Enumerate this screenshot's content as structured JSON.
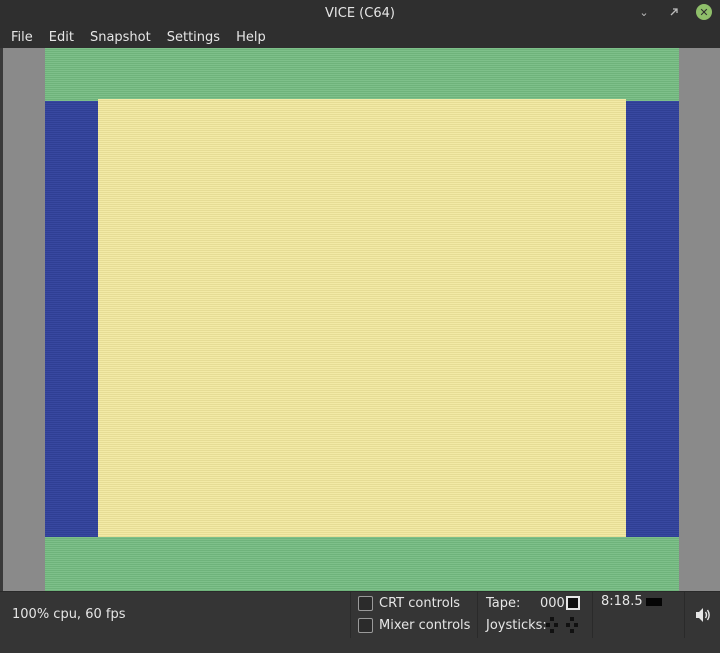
{
  "window": {
    "title": "VICE (C64)"
  },
  "menu": [
    {
      "label": "File"
    },
    {
      "label": "Edit"
    },
    {
      "label": "Snapshot"
    },
    {
      "label": "Settings"
    },
    {
      "label": "Help"
    }
  ],
  "screen_colors": {
    "border_top_bottom": "#7ec08a",
    "border_sides": "#3848a0",
    "background": "#f3eaa6"
  },
  "status": {
    "cpu_fps": "100% cpu, 60 fps",
    "crt_controls_label": "CRT controls",
    "mixer_controls_label": "Mixer controls",
    "crt_controls_checked": false,
    "mixer_controls_checked": false,
    "tape_label": "Tape:",
    "tape_counter": "000",
    "joysticks_label": "Joysticks:",
    "drive_time": "8:18.5"
  },
  "icons": {
    "minimize": "minimize-icon",
    "maximize": "maximize-icon",
    "close": "close-icon",
    "tape_stop": "tape-stop-icon",
    "joysticks": "joystick-icon",
    "drive_led": "drive-led-icon",
    "volume": "volume-icon"
  }
}
